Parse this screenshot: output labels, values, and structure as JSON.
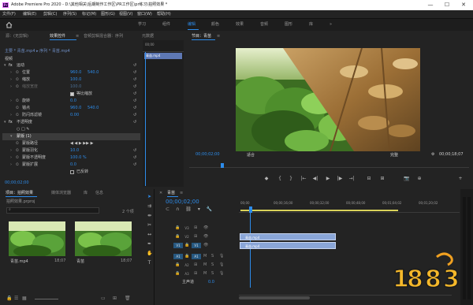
{
  "window": {
    "title": "Adobe Premiere Pro 2020 - D:\\其他相关\\后期制作工作区\\PR工作区\\pr练习\\拍照效果 *",
    "logo": "Pr",
    "min": "—",
    "max": "☐",
    "close": "✕"
  },
  "menu": [
    "文件(F)",
    "编辑(E)",
    "剪辑(C)",
    "序列(S)",
    "标记(M)",
    "图形(G)",
    "视图(V)",
    "窗口(W)",
    "帮助(H)"
  ],
  "workspaces": {
    "home": "home-icon",
    "items": [
      "学习",
      "组件",
      "编辑",
      "颜色",
      "效果",
      "音频",
      "图形",
      "库"
    ],
    "active": 2,
    "more": "»"
  },
  "effect_controls": {
    "tabs": [
      "源：(无剪辑)",
      "效果控件",
      "音频剪辑混合器：序列",
      "元数据"
    ],
    "active_tab": 1,
    "menu_glyph": "≡",
    "clip_path": "主要 * 青苗.mp4  ▸  序列 * 青苗.mp4",
    "timeline_clip": "青苗.mp4",
    "timeline_timecode": "00;00",
    "rows": [
      {
        "type": "section",
        "label": "视频"
      },
      {
        "type": "group",
        "label": "运动"
      },
      {
        "type": "prop",
        "label": "位置",
        "values": [
          "960.0",
          "540.0"
        ]
      },
      {
        "type": "prop",
        "label": "缩放",
        "values": [
          "100.0"
        ]
      },
      {
        "type": "prop",
        "label": "缩放宽度",
        "values": [
          "100.0"
        ],
        "disabled": true
      },
      {
        "type": "check",
        "label": "等比缩放",
        "checked": true
      },
      {
        "type": "prop",
        "label": "旋转",
        "values": [
          "0.0"
        ]
      },
      {
        "type": "prop",
        "label": "锚点",
        "values": [
          "960.0",
          "540.0"
        ]
      },
      {
        "type": "prop",
        "label": "防闪烁滤镜",
        "values": [
          "0.00"
        ]
      },
      {
        "type": "group",
        "label": "不透明度"
      },
      {
        "type": "icons",
        "label": "○ □ ✎"
      },
      {
        "type": "group",
        "label": "蒙版 (1)",
        "highlight": true
      },
      {
        "type": "prop",
        "label": "蒙版路径",
        "values": [
          "◀ ◀ ▶ ▶▶ ▶"
        ]
      },
      {
        "type": "prop",
        "label": "蒙版羽化",
        "values": [
          "10.0"
        ]
      },
      {
        "type": "prop",
        "label": "蒙版不透明度",
        "values": [
          "100.0 %"
        ]
      },
      {
        "type": "prop",
        "label": "蒙版扩展",
        "values": [
          "0.0"
        ]
      },
      {
        "type": "check",
        "label": "已反转",
        "checked": false
      }
    ],
    "timecode": "00;00;02;00"
  },
  "program": {
    "tab": "节目：青苗",
    "menu_glyph": "≡",
    "timecode": "00;00;02;00",
    "fit": "适合",
    "quality": "完整",
    "duration": "00;00;18;07",
    "controls": [
      "◆",
      "{",
      "}",
      "|←",
      "◀|",
      "▶",
      "|▶",
      "→|",
      "⊟",
      "⊞",
      "📷",
      "⊕",
      "+"
    ]
  },
  "project": {
    "tabs": [
      "项目：拍照效果",
      "媒体浏览器",
      "库",
      "信息"
    ],
    "active_tab": 0,
    "file": "拍照效果.prproj",
    "item_count": "2 个项",
    "items": [
      {
        "name": "青苗.mp4",
        "duration": "18;07"
      },
      {
        "name": "青苗",
        "duration": "18;07"
      }
    ]
  },
  "timeline": {
    "tab": "青苗",
    "menu_glyph": "≡",
    "timecode": "00;00;02;00",
    "ruler": [
      "00;00",
      "00;00;16;00",
      "00;00;32;00",
      "00;00;48;00",
      "00;01;04;02",
      "00;01;20;02"
    ],
    "tracks": [
      {
        "name": "V3",
        "kind": "video"
      },
      {
        "name": "V2",
        "kind": "video"
      },
      {
        "name": "V1",
        "kind": "video",
        "selected": true
      },
      {
        "name": "A1",
        "kind": "audio",
        "selected": true
      },
      {
        "name": "A2",
        "kind": "audio"
      },
      {
        "name": "A3",
        "kind": "audio"
      }
    ],
    "master": {
      "label": "主声道",
      "value": "0.0"
    },
    "clips": [
      {
        "track": "V2",
        "label": "青苗.mp4",
        "type": "video"
      },
      {
        "track": "V1",
        "label": "青苗.mp4",
        "type": "video"
      }
    ]
  },
  "watermark": {
    "text": "1883",
    "site": "18183"
  },
  "colors": {
    "accent": "#2d8ceb",
    "video_clip": "#8aa6d8",
    "clip_label": "#5e78b4",
    "selected_track": "#26577f",
    "bg": "#232323",
    "header_bg": "#1d1d1d"
  }
}
